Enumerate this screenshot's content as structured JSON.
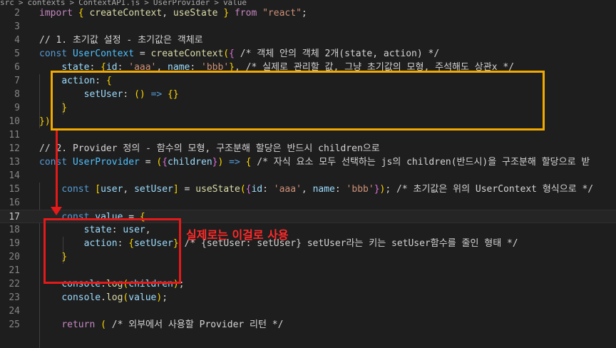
{
  "breadcrumb": {
    "items": [
      "src",
      ">",
      "contexts",
      ">",
      "ContextAPI.js",
      ">",
      "UserProvider",
      ">",
      "value"
    ]
  },
  "lines": [
    {
      "num": "2",
      "text": "import { createContext, useState } from \"react\";"
    },
    {
      "num": "3",
      "text": ""
    },
    {
      "num": "4",
      "text": "// 1. 초기값 설정 - 초기값은 객체로"
    },
    {
      "num": "5",
      "text": "const UserContext = createContext({ /* 객체 안의 객체 2개(state, action) */"
    },
    {
      "num": "6",
      "text": "    state: {id: 'aaa', name: 'bbb'}, /* 실제로 관리할 값, 그냥 초기값의 모형, 주석해도 상관x */"
    },
    {
      "num": "7",
      "text": "    action: {"
    },
    {
      "num": "8",
      "text": "        setUser: () => {}"
    },
    {
      "num": "9",
      "text": "    }"
    },
    {
      "num": "10",
      "text": "})"
    },
    {
      "num": "11",
      "text": ""
    },
    {
      "num": "12",
      "text": "// 2. Provider 정의 - 함수의 모형, 구조분해 할당은 반드시 children으로"
    },
    {
      "num": "13",
      "text": "const UserProvider = ({children}) => { /* 자식 요소 모두 선택하는 js의 children(반드시)을 구조분해 할당으로 받"
    },
    {
      "num": "14",
      "text": ""
    },
    {
      "num": "15",
      "text": "    const [user, setUser] = useState({id: 'aaa', name: 'bbb'}); /* 초기값은 위의 UserContext 형식으로 */"
    },
    {
      "num": "16",
      "text": ""
    },
    {
      "num": "17",
      "text": "    const value = {"
    },
    {
      "num": "18",
      "text": "        state: user,"
    },
    {
      "num": "19",
      "text": "        action: {setUser} /* {setUser: setUser} setUser라는 키는 setUser함수를 줄인 형태 */"
    },
    {
      "num": "20",
      "text": "    }"
    },
    {
      "num": "21",
      "text": ""
    },
    {
      "num": "22",
      "text": "    console.log(children);"
    },
    {
      "num": "23",
      "text": "    console.log(value);"
    },
    {
      "num": "24",
      "text": ""
    },
    {
      "num": "25",
      "text": "    return ( /* 외부에서 사용할 Provider 리턴 */"
    }
  ],
  "current_line": "17",
  "annotation": {
    "text": "실제로는 이걸로 사용"
  },
  "colors": {
    "background": "#1e1e1e",
    "yellow_box": "#f2a900",
    "red_box": "#e41a1a",
    "annotation_text": "#ff2a2a"
  }
}
